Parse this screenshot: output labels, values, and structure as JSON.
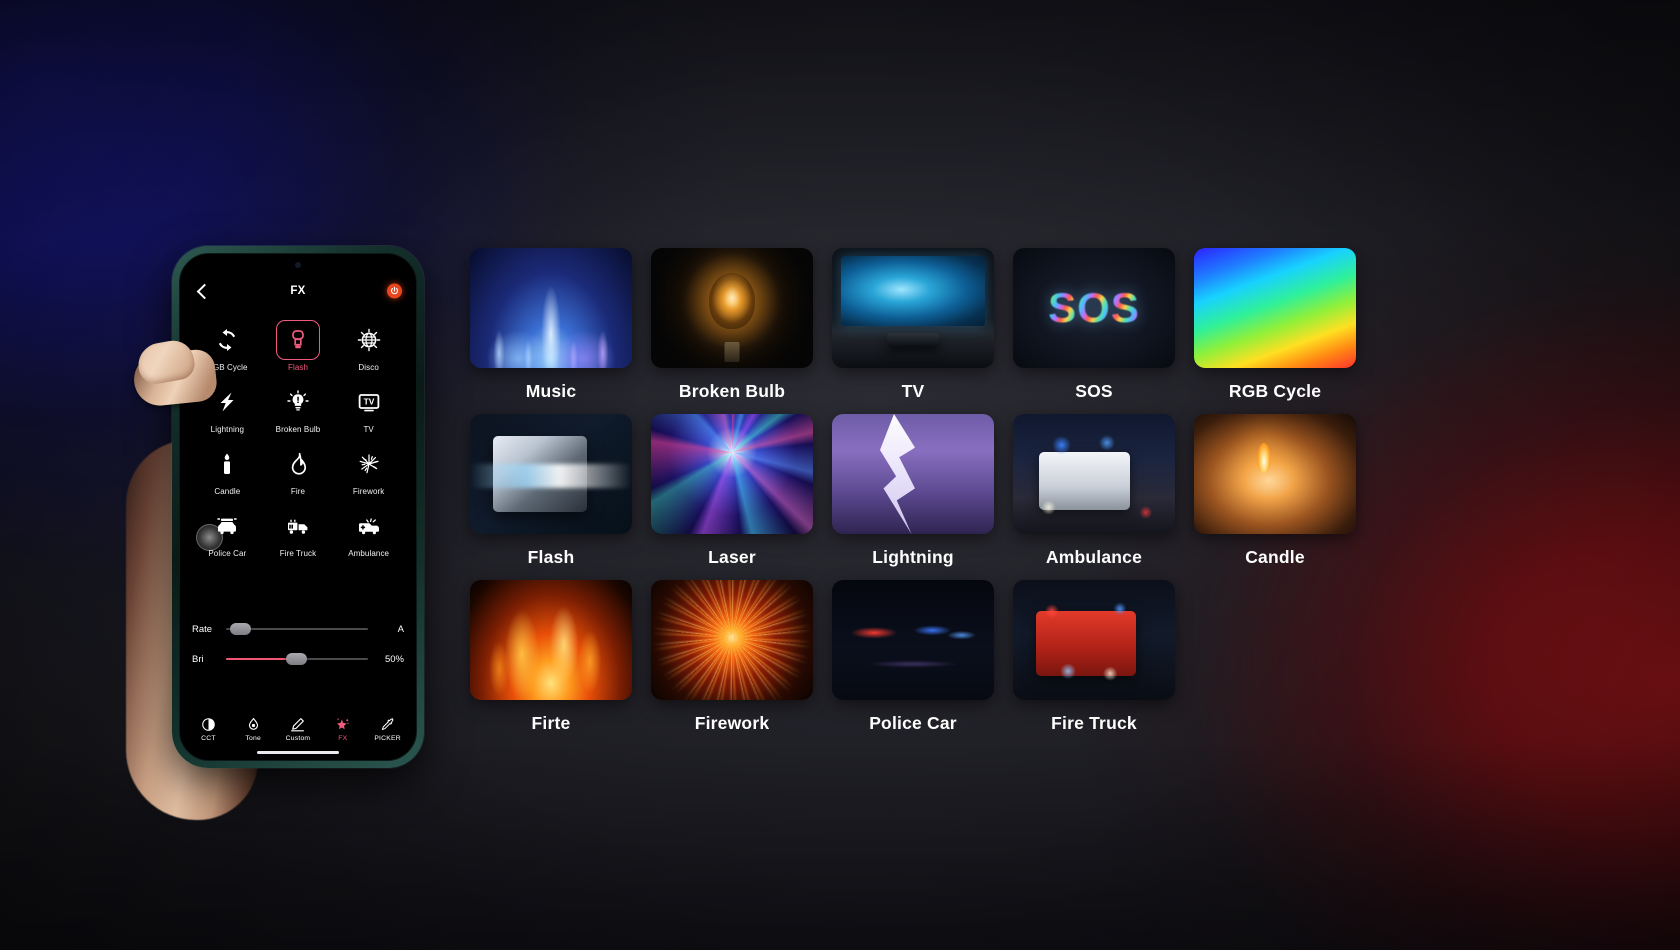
{
  "phone": {
    "header": {
      "back_icon": "back-chevron-icon",
      "title": "FX",
      "power_icon": "power-icon"
    },
    "effects": [
      {
        "label": "RGB Cycle",
        "icon": "rgb-cycle-icon",
        "selected": false
      },
      {
        "label": "Flash",
        "icon": "flash-bulb-icon",
        "selected": true
      },
      {
        "label": "Disco",
        "icon": "disco-ball-icon",
        "selected": false
      },
      {
        "label": "Lightning",
        "icon": "lightning-icon",
        "selected": false
      },
      {
        "label": "Broken Bulb",
        "icon": "broken-bulb-icon",
        "selected": false
      },
      {
        "label": "TV",
        "icon": "tv-icon",
        "selected": false
      },
      {
        "label": "Candle",
        "icon": "candle-icon",
        "selected": false
      },
      {
        "label": "Fire",
        "icon": "fire-icon",
        "selected": false
      },
      {
        "label": "Firework",
        "icon": "firework-icon",
        "selected": false
      },
      {
        "label": "Police Car",
        "icon": "police-car-icon",
        "selected": false
      },
      {
        "label": "Fire Truck",
        "icon": "fire-truck-icon",
        "selected": false
      },
      {
        "label": "Ambulance",
        "icon": "ambulance-icon",
        "selected": false
      }
    ],
    "sliders": [
      {
        "label": "Rate",
        "value": "A",
        "percent": 8,
        "filled": false
      },
      {
        "label": "Bri",
        "value": "50%",
        "percent": 50,
        "filled": true
      }
    ],
    "tabs": [
      {
        "label": "CCT",
        "icon": "contrast-circle-icon",
        "active": false
      },
      {
        "label": "Tone",
        "icon": "droplet-icon",
        "active": false
      },
      {
        "label": "Custom",
        "icon": "pen-icon",
        "active": false
      },
      {
        "label": "FX",
        "icon": "sparkle-star-icon",
        "active": true
      },
      {
        "label": "PICKER",
        "icon": "eyedropper-icon",
        "active": false
      }
    ],
    "accent_color": "#ef5a7d",
    "power_color": "#e8461f"
  },
  "gallery": {
    "rows": [
      [
        {
          "label": "Music",
          "art": "t-music"
        },
        {
          "label": "Broken Bulb",
          "art": "t-bulb"
        },
        {
          "label": "TV",
          "art": "t-tv"
        },
        {
          "label": "SOS",
          "art": "t-sos",
          "overlay_text": "SOS"
        },
        {
          "label": "RGB Cycle",
          "art": "t-rgb"
        }
      ],
      [
        {
          "label": "Flash",
          "art": "t-flash"
        },
        {
          "label": "Laser",
          "art": "t-laser"
        },
        {
          "label": "Lightning",
          "art": "t-lightning"
        },
        {
          "label": "Ambulance",
          "art": "t-ambulance"
        },
        {
          "label": "Candle",
          "art": "t-candle2"
        }
      ],
      [
        {
          "label": "Firte",
          "art": "t-fire"
        },
        {
          "label": "Firework",
          "art": "t-firework"
        },
        {
          "label": "Police Car",
          "art": "t-police"
        },
        {
          "label": "Fire Truck",
          "art": "t-firetruck"
        }
      ]
    ]
  },
  "background": {
    "top_left_glow": "#14146e",
    "bottom_right_glow": "#6e1014",
    "base": "#1a1a20"
  }
}
